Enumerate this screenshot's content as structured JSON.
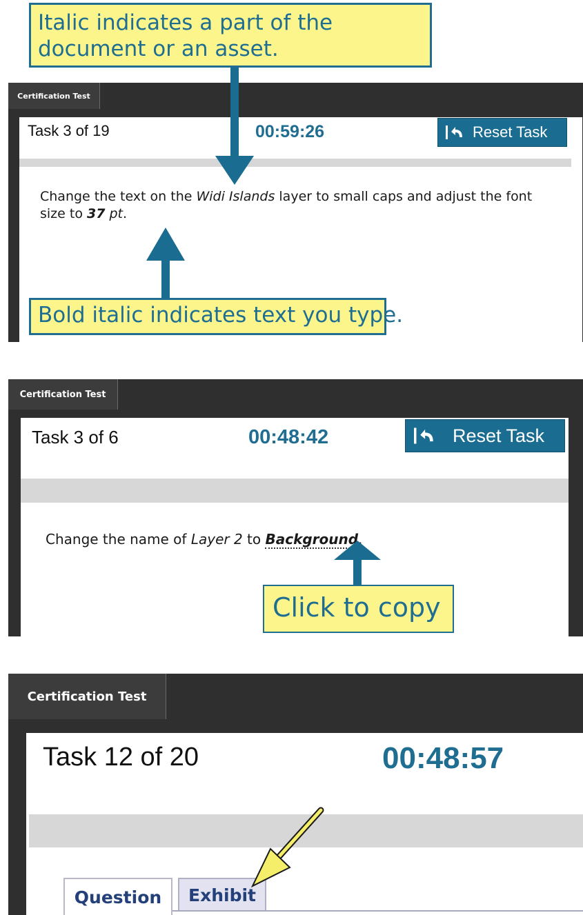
{
  "panels": [
    {
      "tab_label": "Certification Test",
      "task_counter": "Task 3 of 19",
      "timer": "00:59:26",
      "reset_label": "Reset Task",
      "question": {
        "t1": "Change the text on the ",
        "t2": "Widi Islands",
        "t3": " layer to small caps and adjust the font size to ",
        "t4": "37",
        "t5": " pt",
        "t6": "."
      },
      "callout_top": "Italic indicates a part of the document or an asset.",
      "callout_bottom": "Bold italic indicates text you type."
    },
    {
      "tab_label": "Certification Test",
      "task_counter": "Task 3 of 6",
      "timer": "00:48:42",
      "reset_label": "Reset Task",
      "question": {
        "t1": "Change the name of ",
        "t2": "Layer 2",
        "t3": " to ",
        "t4": "Background",
        "t5": "."
      },
      "callout": "Click to copy"
    },
    {
      "tab_label": "Certification Test",
      "task_counter": "Task 12 of 20",
      "timer": "00:48:57",
      "tabs": [
        "Question",
        "Exhibit"
      ]
    }
  ],
  "colors": {
    "accent": "#1f6e92",
    "callout_fill": "#fcf58c",
    "frame": "#2f2f2f",
    "tab_active_bg": "#3c3c3c",
    "gray_band": "#d7d7d7"
  },
  "icons": [
    "reset-arrow-icon"
  ]
}
